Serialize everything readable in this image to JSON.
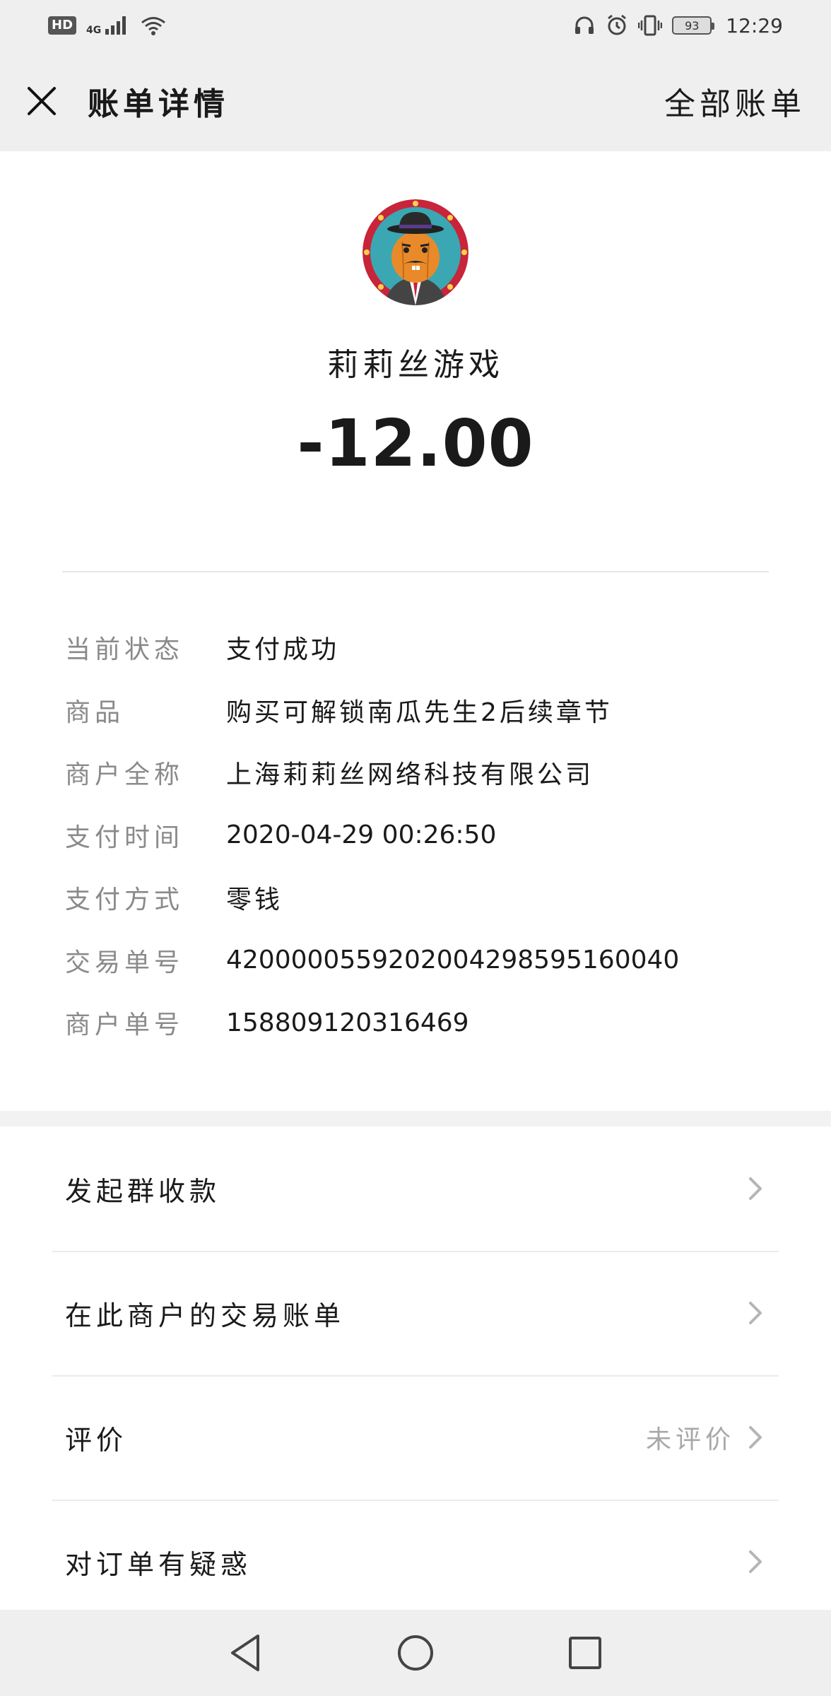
{
  "status_bar": {
    "hd": "HD",
    "network": "4G",
    "battery": "93",
    "time": "12:29",
    "icons": [
      "signal-icon",
      "wifi-icon",
      "headphones-icon",
      "alarm-icon",
      "vibrate-icon"
    ]
  },
  "header": {
    "title": "账单详情",
    "all_bills": "全部账单",
    "close_icon": "close-icon"
  },
  "merchant": {
    "name": "莉莉丝游戏",
    "amount": "-12.00"
  },
  "details": [
    {
      "label": "当前状态",
      "value": "支付成功"
    },
    {
      "label": "商品",
      "value": "购买可解锁南瓜先生2后续章节"
    },
    {
      "label": "商户全称",
      "value": "上海莉莉丝网络科技有限公司"
    },
    {
      "label": "支付时间",
      "value": "2020-04-29 00:26:50"
    },
    {
      "label": "支付方式",
      "value": "零钱"
    },
    {
      "label": "交易单号",
      "value": "4200000559202004298595160040"
    },
    {
      "label": "商户单号",
      "value": "158809120316469"
    }
  ],
  "menu": [
    {
      "label": "发起群收款",
      "extra": ""
    },
    {
      "label": "在此商户的交易账单",
      "extra": ""
    },
    {
      "label": "评价",
      "extra": "未评价"
    },
    {
      "label": "对订单有疑惑",
      "extra": ""
    }
  ],
  "nav": {
    "icons": [
      "back-icon",
      "home-icon",
      "recents-icon"
    ]
  },
  "colors": {
    "bar_bg": "#efefef",
    "label_gray": "#8a8a8a",
    "text": "#1a1a1a"
  }
}
